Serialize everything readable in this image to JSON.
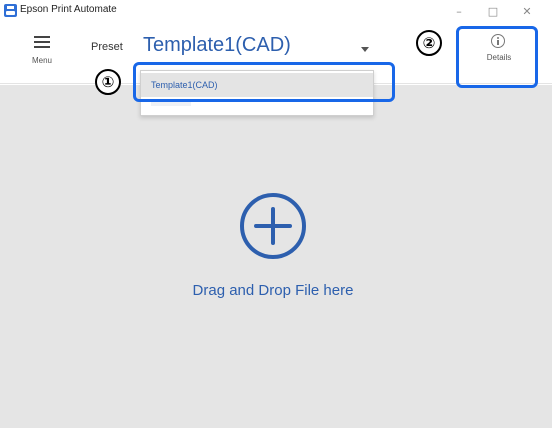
{
  "window": {
    "title": "Epson Print Automate",
    "minimize_glyph": "–",
    "maximize_glyph": "□",
    "close_glyph": "✕"
  },
  "header": {
    "menu_label": "Menu",
    "preset_label": "Preset",
    "preset_value": "Template1(CAD)",
    "details_label": "Details"
  },
  "dropdown": {
    "options": [
      "Template1(CAD)"
    ]
  },
  "drop_area": {
    "text": "Drag and Drop File here"
  },
  "callouts": [
    "①",
    "②"
  ],
  "colors": {
    "accent_text": "#2d5fae",
    "callout_border": "#1867e8",
    "drop_area_bg": "#e5e5e5"
  },
  "icons": [
    "app-logo-icon",
    "hamburger-icon",
    "chevron-down-icon",
    "info-icon",
    "plus-circle-icon"
  ]
}
